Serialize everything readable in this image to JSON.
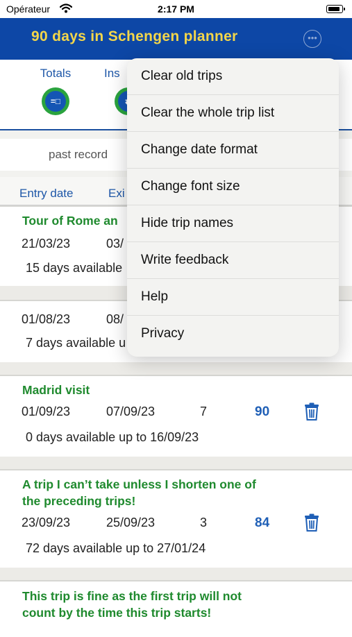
{
  "status": {
    "carrier": "Opérateur",
    "time": "2:17 PM"
  },
  "header": {
    "title": "90 days in Schengen planner",
    "more_icon": "ellipsis-circle-icon"
  },
  "tabs": [
    {
      "label": "Totals",
      "icon": "totals-icon",
      "glyph": "=□"
    },
    {
      "label": "Ins",
      "icon": "insights-icon",
      "glyph": "⇄"
    }
  ],
  "subbar": {
    "past": "past record"
  },
  "columns": {
    "entry": "Entry date",
    "exit": "Exi"
  },
  "trips": [
    {
      "name": "Tour of Rome an",
      "entry": "21/03/23",
      "exit": "03/",
      "length": "",
      "days": "",
      "avail": "15 days available"
    },
    {
      "name": "",
      "entry": "01/08/23",
      "exit": "08/",
      "length": "",
      "days": "",
      "avail": "7 days available u"
    },
    {
      "name": "Madrid visit",
      "entry": "01/09/23",
      "exit": "07/09/23",
      "length": "7",
      "days": "90",
      "avail": "0 days available up to  16/09/23"
    },
    {
      "name_line1": "A trip I can’t take unless I shorten one of",
      "name_line2": "the preceding trips!",
      "entry": "23/09/23",
      "exit": "25/09/23",
      "length": "3",
      "days": "84",
      "avail": "72 days available up to  27/01/24"
    },
    {
      "name_line1": "This trip is fine as the first trip will not",
      "name_line2": "count by the time this trip starts!"
    }
  ],
  "menu": {
    "items": [
      "Clear old trips",
      "Clear the whole trip list",
      "Change date format",
      "Change font size",
      "Hide trip names",
      "Write feedback",
      "Help",
      "Privacy"
    ]
  },
  "colors": {
    "header": "#0d47a6",
    "title": "#f3d64a",
    "trip_name": "#1f8a2e",
    "accent": "#1f5fb6"
  }
}
